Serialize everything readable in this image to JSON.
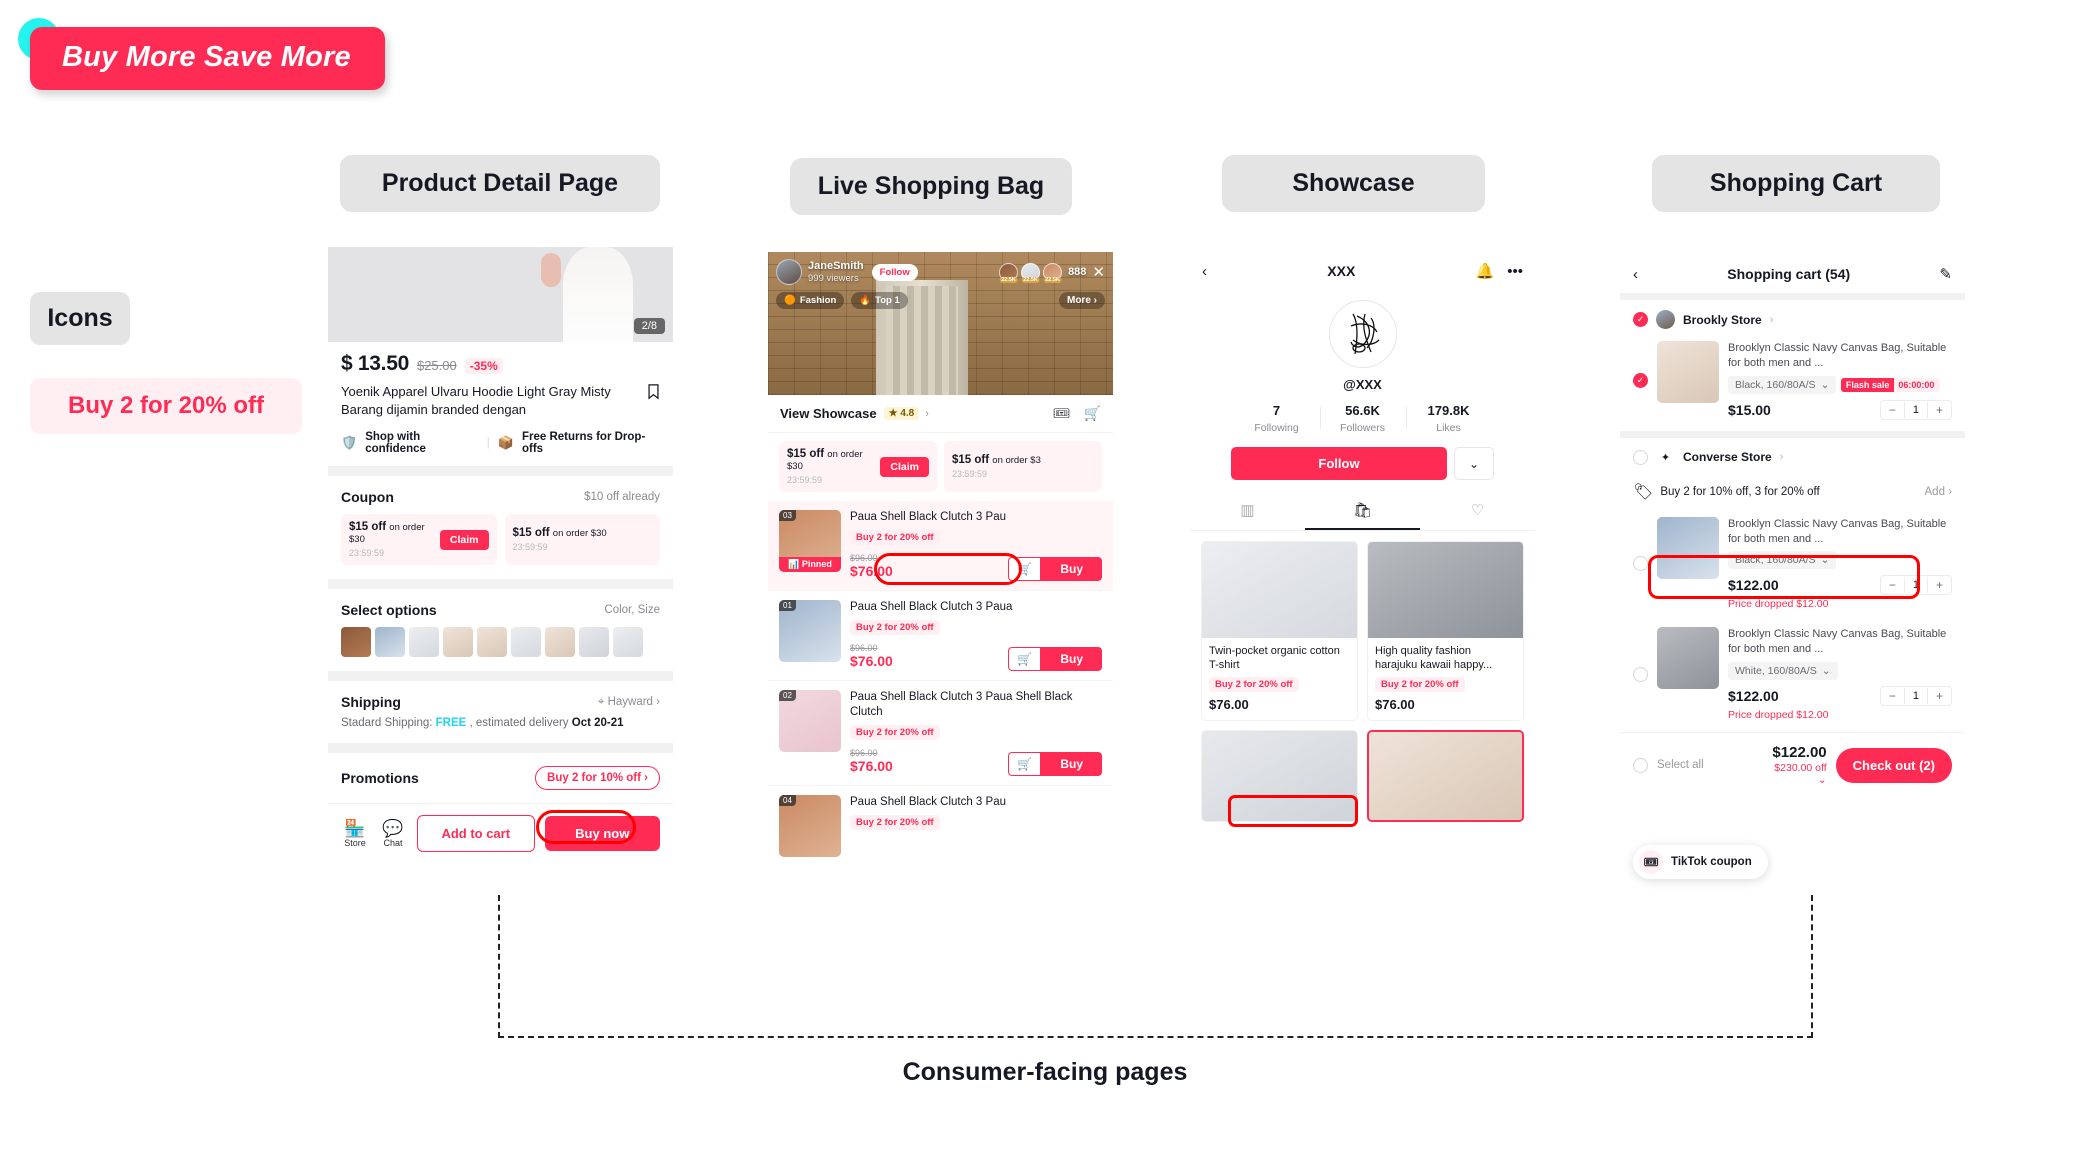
{
  "banner": {
    "title": "Buy More Save More"
  },
  "icons_section": {
    "label": "Icons",
    "chip": "Buy 2 for 20% off"
  },
  "headers": {
    "pdp": "Product Detail Page",
    "live": "Live Shopping Bag",
    "showcase": "Showcase",
    "cart": "Shopping Cart"
  },
  "caption": "Consumer-facing pages",
  "colors": {
    "accent": "#FE2C55",
    "accent_soft": "#FFEFF2",
    "cyan": "#25F4EE",
    "highlight": "#FF0000"
  },
  "pdp": {
    "image_counter": "2/8",
    "price": "$ 13.50",
    "price_original": "$25.00",
    "discount": "-35%",
    "title": "Yoenik Apparel Ulvaru Hoodie Light Gray Misty Barang dijamin branded dengan",
    "bookmark_icon": "bookmark-icon",
    "trust": {
      "left": "Shop with confidence",
      "right": "Free Returns for Drop-offs"
    },
    "coupon_section": {
      "title": "Coupon",
      "aside": "$10 off already"
    },
    "coupons": [
      {
        "amount": "$15 off",
        "condition": "on order $30",
        "timer": "23:59:59",
        "action": "Claim"
      },
      {
        "amount": "$15 off",
        "condition": "on order $30",
        "timer": "23:59:59",
        "action": ""
      }
    ],
    "options": {
      "title": "Select options",
      "aside": "Color, Size"
    },
    "option_count": 9,
    "shipping": {
      "title": "Shipping",
      "location": "Hayward",
      "desc_prefix": "Stadard Shipping: ",
      "free": "FREE",
      "desc_mid": " , estimated delivery ",
      "date": "Oct 20-21"
    },
    "promotions": {
      "title": "Promotions",
      "chip": "Buy 2 for 10% off"
    },
    "footer": {
      "store": "Store",
      "chat": "Chat",
      "add_to_cart": "Add to cart",
      "buy_now": "Buy now"
    }
  },
  "live": {
    "host": "JaneSmith",
    "viewers": "999 viewers",
    "follow": "Follow",
    "viewer_badges": [
      "22.5K",
      "22.5K",
      "22.5K"
    ],
    "viewer_count": "888",
    "close_icon": "close-icon",
    "tags": [
      "Fashion",
      "Top 1"
    ],
    "more": "More",
    "showcase_row": {
      "label": "View Showcase",
      "rating": "4.8"
    },
    "coupons": [
      {
        "amount": "$15 off",
        "condition": "on order $30",
        "timer": "23:59:59",
        "action": "Claim"
      },
      {
        "amount": "$15 off",
        "condition": "on order $3",
        "timer": "23:59:59",
        "action": ""
      }
    ],
    "products": [
      {
        "idx": "03",
        "name": "Paua Shell Black Clutch 3 Pau",
        "deal": "Buy 2 for 20% off",
        "price_old": "$96.00",
        "price": "$76.00",
        "pinned": "Pinned",
        "buy": "Buy",
        "highlight": true
      },
      {
        "idx": "01",
        "name": "Paua Shell Black Clutch 3 Paua",
        "deal": "Buy 2 for 20% off",
        "price_old": "$96.00",
        "price": "$76.00",
        "pinned": "",
        "buy": "Buy",
        "highlight": false
      },
      {
        "idx": "02",
        "name": "Paua Shell Black Clutch 3 Paua Shell Black Clutch",
        "deal": "Buy 2 for 20% off",
        "price_old": "$96.00",
        "price": "$76.00",
        "pinned": "",
        "buy": "Buy",
        "highlight": false
      },
      {
        "idx": "04",
        "name": "Paua Shell Black Clutch 3 Pau",
        "deal": "Buy 2 for 20% off",
        "price_old": "",
        "price": "",
        "pinned": "",
        "buy": "",
        "highlight": false
      }
    ]
  },
  "showcase": {
    "title": "XXX",
    "back_icon": "back-arrow-icon",
    "bell_icon": "bell-icon",
    "more_icon": "more-dots-icon",
    "handle": "@XXX",
    "stats": [
      {
        "value": "7",
        "label": "Following"
      },
      {
        "value": "56.6K",
        "label": "Followers"
      },
      {
        "value": "179.8K",
        "label": "Likes"
      }
    ],
    "follow": "Follow",
    "tabs": [
      "grid-tab",
      "shop-tab",
      "liked-tab"
    ],
    "products": [
      {
        "name": "Twin-pocket organic cotton T-shirt",
        "deal": "Buy 2 for 20% off",
        "price": "$76.00",
        "highlight": true
      },
      {
        "name": "High quality fashion harajuku kawaii happy...",
        "deal": "Buy 2 for 20% off",
        "price": "$76.00",
        "highlight": false
      }
    ]
  },
  "cart": {
    "title": "Shopping cart (54)",
    "back_icon": "back-arrow-icon",
    "edit_icon": "edit-icon",
    "stores": [
      {
        "name": "Brookly Store",
        "selected": true,
        "promo": null,
        "items": [
          {
            "selected": true,
            "name": "Brooklyn Classic Navy Canvas Bag, Suitable for both men and ...",
            "spec": "Black, 160/80A/S",
            "flash_label": "Flash sale",
            "flash_timer": "06:00:00",
            "price": "$15.00",
            "qty": "1",
            "dropped": null
          }
        ]
      },
      {
        "name": "Converse Store",
        "selected": false,
        "promo": {
          "text": "Buy 2 for 10% off, 3 for 20% off",
          "add": "Add"
        },
        "items": [
          {
            "selected": false,
            "name": "Brooklyn Classic Navy Canvas Bag, Suitable for both men and ...",
            "spec": "Black, 160/80A/S",
            "flash_label": null,
            "flash_timer": null,
            "price": "$122.00",
            "qty": "1",
            "dropped": "Price dropped $12.00"
          },
          {
            "selected": false,
            "name": "Brooklyn Classic Navy Canvas Bag, Suitable for both men and ...",
            "spec": "White, 160/80A/S",
            "flash_label": null,
            "flash_timer": null,
            "price": "$122.00",
            "qty": "1",
            "dropped": "Price dropped $12.00"
          }
        ]
      }
    ],
    "tiktok_coupon": "TikTok coupon",
    "footer": {
      "select_all": "Select all",
      "total": "$122.00",
      "off": "$230.00 off",
      "checkout": "Check out (2)"
    }
  }
}
